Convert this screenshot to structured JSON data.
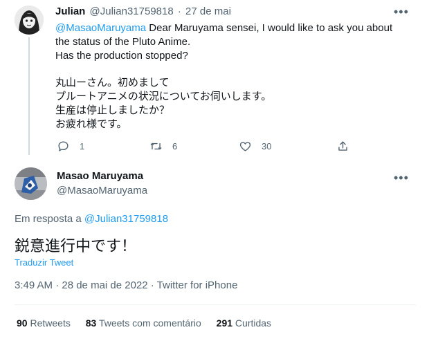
{
  "parent_tweet": {
    "display_name": "Julian",
    "handle": "@Julian31759818",
    "separator": "·",
    "date": "27 de mai",
    "mention": "@MasaoMaruyama",
    "text_line1": " Dear Maruyama sensei, I would like to ask you about",
    "text_line2": "the status of the Pluto Anime.",
    "text_line3": "Has the production stopped?",
    "jp_line1": "丸山ーさん。初めまして",
    "jp_line2": "プルートアニメの状況についてお伺いします。",
    "jp_line3": "生産は停止しましたか？",
    "jp_line4": "お疲れ様です。",
    "reply_count": "1",
    "retweet_count": "6",
    "like_count": "30",
    "more_label": "•••"
  },
  "main_tweet": {
    "display_name": "Masao Maruyama",
    "handle": "@MasaoMaruyama",
    "more_label": "•••",
    "replying_prefix": "Em resposta a",
    "replying_to": "@Julian31759818",
    "text": "鋭意進行中です！",
    "translate_label": "Traduzir Tweet",
    "timestamp": "3:49 AM · 28 de mai de 2022 · Twitter for iPhone",
    "stats": {
      "retweets_count": "90",
      "retweets_label": "Retweets",
      "quotes_count": "83",
      "quotes_label": "Tweets com comentário",
      "likes_count": "291",
      "likes_label": "Curtidas"
    }
  },
  "colors": {
    "link": "#1d9bf0",
    "muted": "#536471",
    "text": "#0f1419",
    "divider": "#eff3f4"
  },
  "icons": [
    "reply-icon",
    "retweet-icon",
    "like-icon",
    "share-icon",
    "more-icon"
  ]
}
